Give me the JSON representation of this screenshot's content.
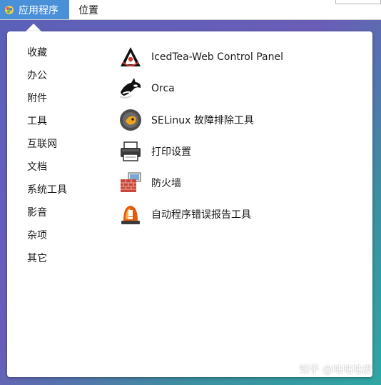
{
  "topbar": {
    "apps_menu_label": "应用程序",
    "places_menu_label": "位置"
  },
  "categories": [
    "收藏",
    "办公",
    "附件",
    "工具",
    "互联网",
    "文档",
    "系统工具",
    "影音",
    "杂项",
    "其它"
  ],
  "apps": [
    {
      "label": "IcedTea-Web Control Panel",
      "icon": "java-duke-icon"
    },
    {
      "label": "Orca",
      "icon": "orca-whale-icon"
    },
    {
      "label": "SELinux 故障排除工具",
      "icon": "selinux-icon"
    },
    {
      "label": "打印设置",
      "icon": "printer-icon"
    },
    {
      "label": "防火墙",
      "icon": "firewall-icon"
    },
    {
      "label": "自动程序错误报告工具",
      "icon": "alarm-light-icon"
    }
  ],
  "watermark": "知乎 @咕咕咕皮",
  "colors": {
    "apps_menu_bg": "#4a90d9",
    "popup_bg": "#ffffff"
  }
}
